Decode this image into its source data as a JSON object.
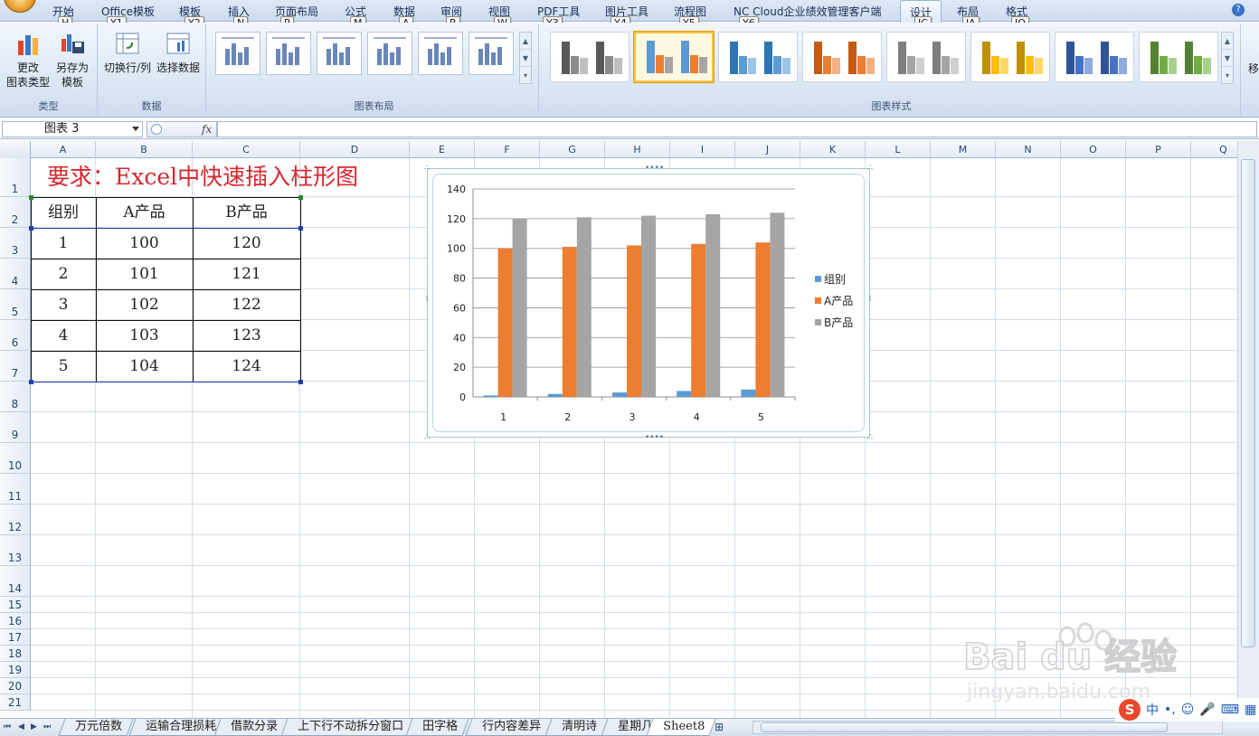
{
  "ribbon": {
    "tabs": [
      {
        "label": "开始",
        "key": "H"
      },
      {
        "label": "Office模板",
        "key": "Y1"
      },
      {
        "label": "模板",
        "key": "Y2"
      },
      {
        "label": "插入",
        "key": "N"
      },
      {
        "label": "页面布局",
        "key": "P"
      },
      {
        "label": "公式",
        "key": "M"
      },
      {
        "label": "数据",
        "key": "A"
      },
      {
        "label": "审阅",
        "key": "R"
      },
      {
        "label": "视图",
        "key": "W"
      },
      {
        "label": "PDF工具",
        "key": "Y3"
      },
      {
        "label": "图片工具",
        "key": "Y4"
      },
      {
        "label": "流程图",
        "key": "Y5"
      },
      {
        "label": "NC Cloud企业绩效管理客户端",
        "key": "Y6"
      },
      {
        "label": "设计",
        "key": "JC"
      },
      {
        "label": "布局",
        "key": "JA"
      },
      {
        "label": "格式",
        "key": "JO"
      }
    ],
    "help_icon": "?",
    "groups": {
      "type": {
        "label": "类型",
        "change_type": "更改\n图表类型",
        "save_template": "另存为\n模板"
      },
      "data": {
        "label": "数据",
        "switch_row_col": "切换行/列",
        "select_data": "选择数据"
      },
      "layout": {
        "label": "图表布局"
      },
      "styles": {
        "label": "图表样式"
      }
    },
    "cut_off_label": "移"
  },
  "formula_bar": {
    "name_box": "图表 3",
    "fx": "fx",
    "value": ""
  },
  "sheet": {
    "columns": [
      "A",
      "B",
      "C",
      "D",
      "E",
      "F",
      "G",
      "H",
      "I",
      "J",
      "K",
      "L",
      "M",
      "N",
      "O",
      "P",
      "Q"
    ],
    "rows": [
      "1",
      "2",
      "3",
      "4",
      "5",
      "6",
      "7",
      "8",
      "9",
      "10",
      "11",
      "12",
      "13",
      "14",
      "15",
      "16",
      "17",
      "18",
      "19",
      "20",
      "21"
    ],
    "title": "要求：Excel中快速插入柱形图",
    "table": {
      "headers": [
        "组别",
        "A产品",
        "B产品"
      ],
      "rows": [
        [
          "1",
          "100",
          "120"
        ],
        [
          "2",
          "101",
          "121"
        ],
        [
          "3",
          "102",
          "122"
        ],
        [
          "4",
          "103",
          "123"
        ],
        [
          "5",
          "104",
          "124"
        ]
      ]
    }
  },
  "chart_data": {
    "type": "bar",
    "categories": [
      "1",
      "2",
      "3",
      "4",
      "5"
    ],
    "series": [
      {
        "name": "组别",
        "values": [
          1,
          2,
          3,
          4,
          5
        ],
        "color": "#5b9bd5"
      },
      {
        "name": "A产品",
        "values": [
          100,
          101,
          102,
          103,
          104
        ],
        "color": "#ed7d31"
      },
      {
        "name": "B产品",
        "values": [
          120,
          121,
          122,
          123,
          124
        ],
        "color": "#a5a5a5"
      }
    ],
    "ylim": [
      0,
      140
    ],
    "yticks": [
      "0",
      "20",
      "40",
      "60",
      "80",
      "100",
      "120",
      "140"
    ],
    "grid": true,
    "legend": "right",
    "title": "",
    "xlabel": "",
    "ylabel": ""
  },
  "sheet_tabs": {
    "tabs": [
      "万元倍数",
      "运输合理损耗",
      "借款分录",
      "上下行不动拆分窗口",
      "田字格",
      "行内容差异",
      "清明诗",
      "星期几",
      "Sheet8"
    ],
    "active": "Sheet8"
  },
  "watermark": {
    "line1": "Bai du 经验",
    "line2": "jingyan.baidu.com"
  },
  "ime": {
    "logo": "S",
    "mode": "中",
    "punct": "•,",
    "emoji": "☺",
    "mic": "🎤",
    "keyboard": "⌨",
    "grid": "▦"
  }
}
